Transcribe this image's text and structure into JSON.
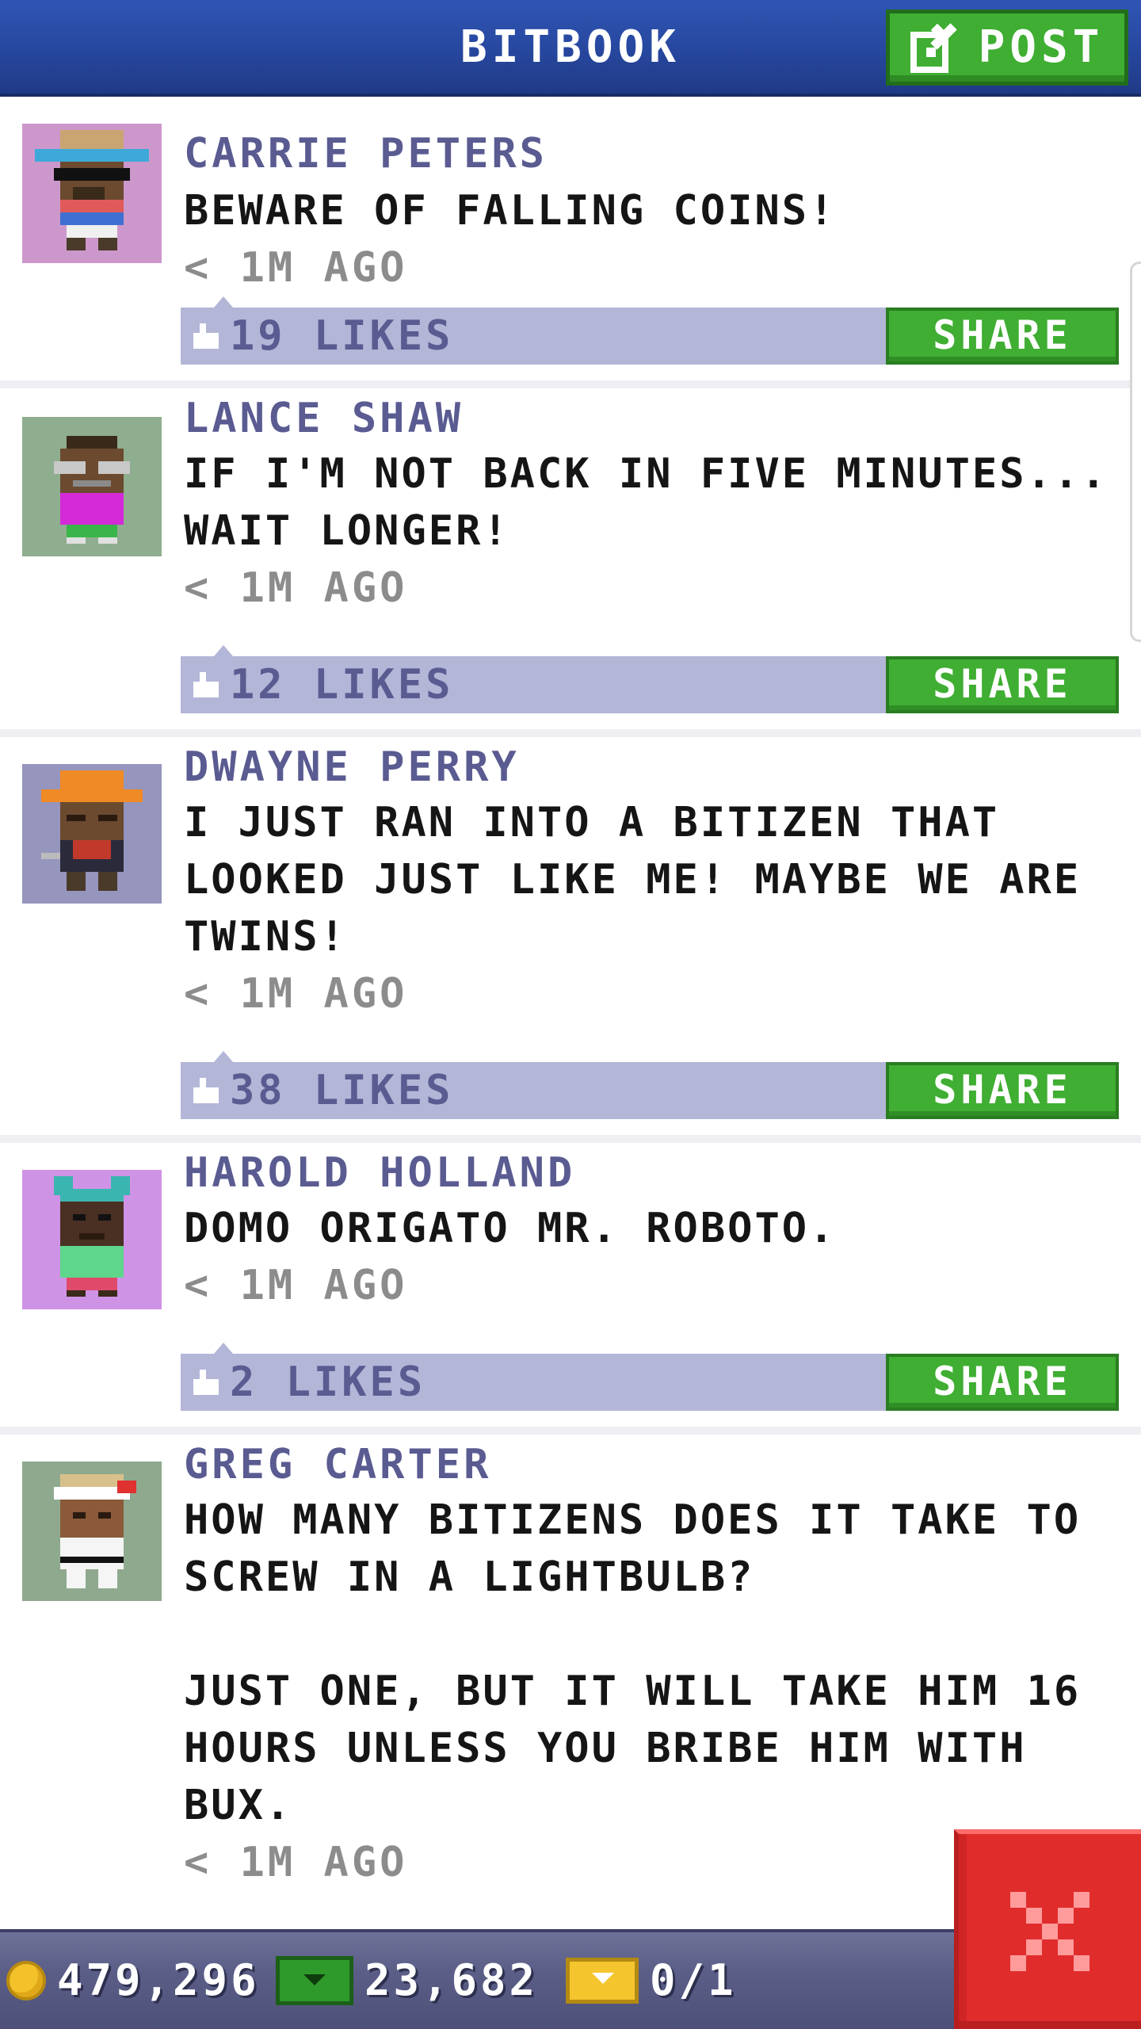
{
  "header": {
    "title": "BITBOOK",
    "post_label": "POST"
  },
  "posts": [
    {
      "author": "CARRIE PETERS",
      "message": "BEWARE OF FALLING COINS!",
      "time": "< 1M AGO",
      "likes": "19 LIKES",
      "share": "SHARE",
      "avatar_bg": "#cc98cc"
    },
    {
      "author": "LANCE SHAW",
      "message": "IF I'M NOT BACK IN FIVE MINUTES...\nWAIT LONGER!",
      "time": "< 1M AGO",
      "likes": "12 LIKES",
      "share": "SHARE",
      "avatar_bg": "#8fae8f"
    },
    {
      "author": "DWAYNE PERRY",
      "message": "I JUST RAN INTO A BITIZEN THAT\nLOOKED JUST LIKE ME! MAYBE WE ARE\nTWINS!",
      "time": "< 1M AGO",
      "likes": "38 LIKES",
      "share": "SHARE",
      "avatar_bg": "#9595bd"
    },
    {
      "author": "HAROLD HOLLAND",
      "message": "DOMO ORIGATO MR. ROBOTO.",
      "time": "< 1M AGO",
      "likes": "2 LIKES",
      "share": "SHARE",
      "avatar_bg": "#cf93e6"
    },
    {
      "author": "GREG CARTER",
      "message": "HOW MANY BITIZENS DOES IT TAKE TO\nSCREW IN A LIGHTBULB?\n\nJUST ONE, BUT IT WILL TAKE HIM 16\nHOURS UNLESS YOU BRIBE HIM WITH\nBUX.",
      "time": "< 1M AGO",
      "avatar_bg": "#8fa98f"
    }
  ],
  "currency": {
    "coins": "479,296",
    "bux": "23,682",
    "tickets": "0/1"
  },
  "icons": {
    "post": "edit-icon",
    "like": "thumbs-up-icon",
    "close": "close-icon",
    "coin": "coin-icon",
    "bux": "bux-icon",
    "ticket": "ticket-icon"
  },
  "colors": {
    "header_blue": "#27479e",
    "button_green": "#3fae32",
    "likes_bar": "#b3b6d7",
    "name_purple": "#5a5b91",
    "close_red": "#e12c2c",
    "bottom_bar": "#5b5e87"
  }
}
